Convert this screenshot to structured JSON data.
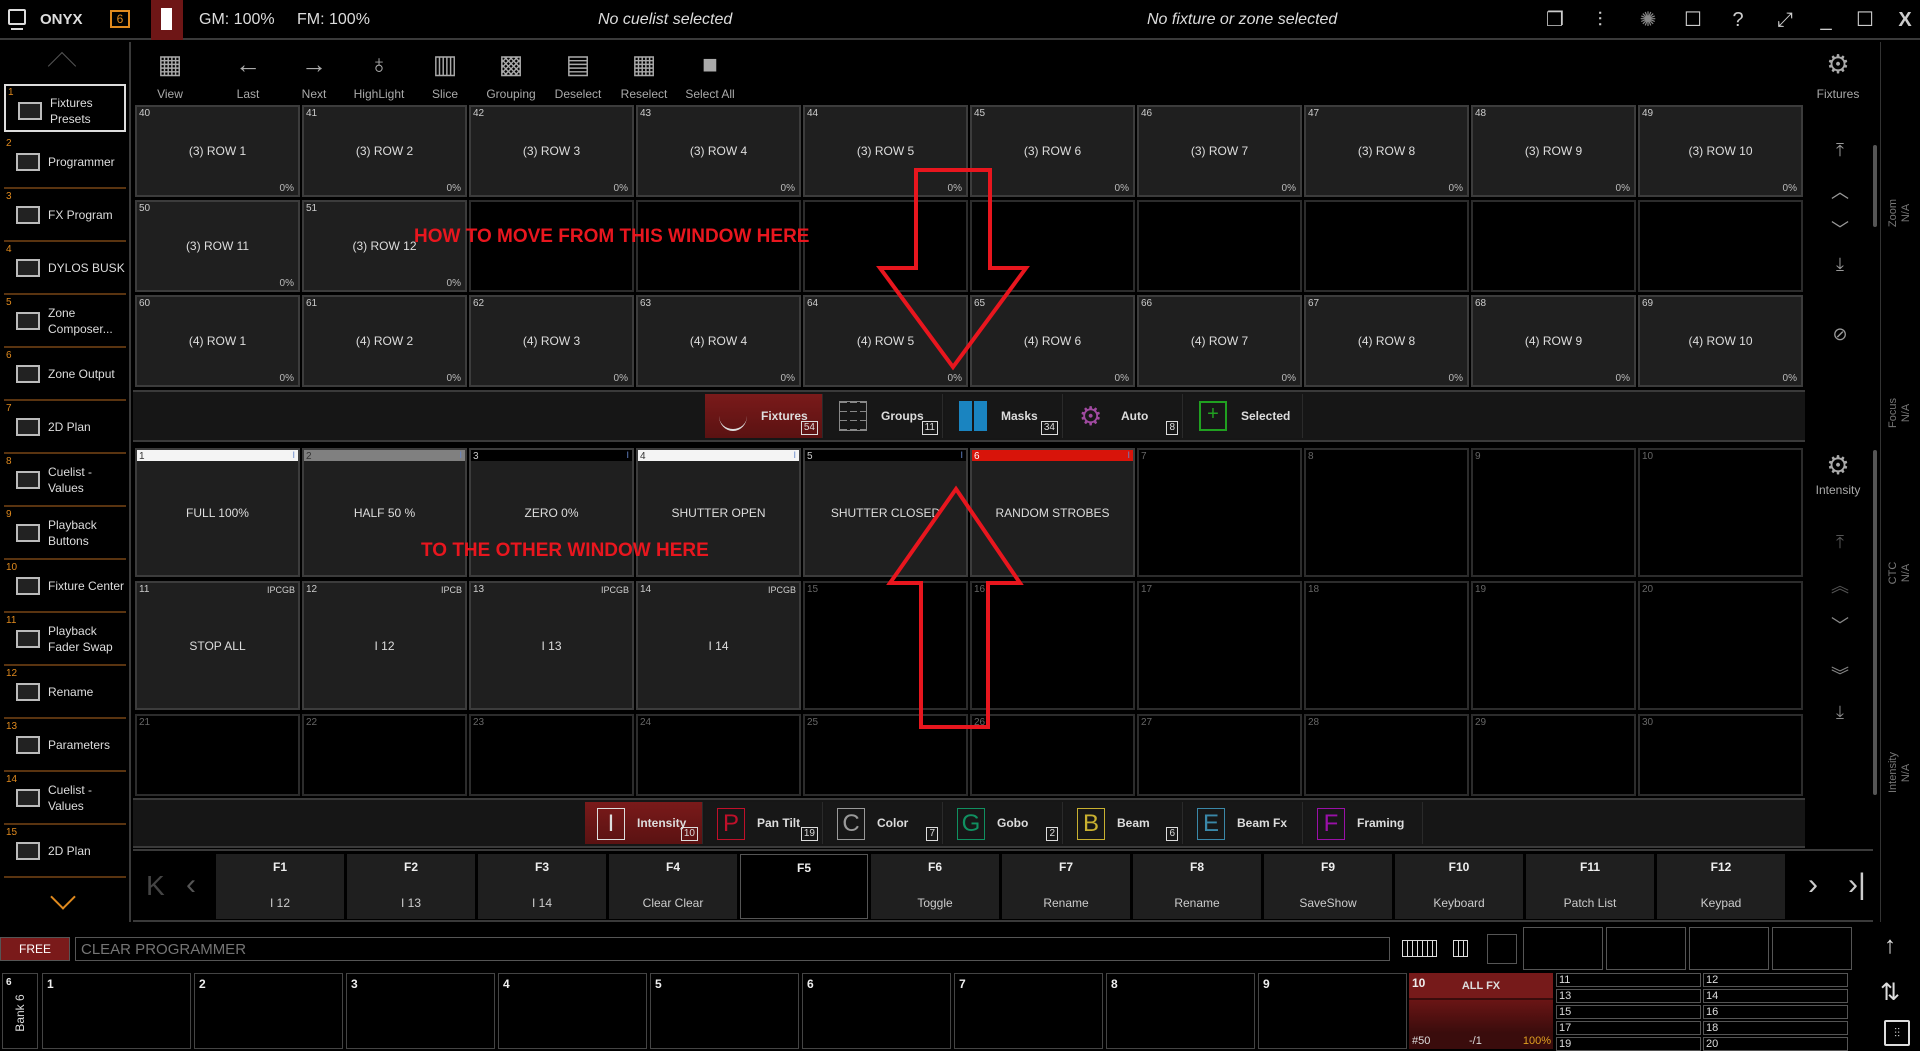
{
  "topbar": {
    "app": "ONYX",
    "gm": "GM: 100%",
    "fm": "FM: 100%",
    "cuelist_status": "No cuelist selected",
    "fixture_status": "No fixture or zone selected",
    "icons": [
      "windows-icon",
      "sliders-icon",
      "spinner-icon",
      "chat-icon",
      "help-icon",
      "fullscreen-icon",
      "minimize-icon",
      "maximize-icon",
      "close-icon"
    ],
    "help_glyph": "?",
    "close_glyph": "X",
    "accent": "#e08a1e"
  },
  "sidebar": {
    "items": [
      {
        "num": "1",
        "label": "Fixtures Presets",
        "icon": "asterisk-icon"
      },
      {
        "num": "2",
        "label": "Programmer",
        "icon": "bars-icon"
      },
      {
        "num": "3",
        "label": "FX Program",
        "icon": "window-icon"
      },
      {
        "num": "4",
        "label": "DYLOS BUSK",
        "icon": "window-icon"
      },
      {
        "num": "5",
        "label": "Zone Composer...",
        "icon": "window-icon"
      },
      {
        "num": "6",
        "label": "Zone Output",
        "icon": "film-play-icon"
      },
      {
        "num": "7",
        "label": "2D Plan",
        "icon": "window-icon"
      },
      {
        "num": "8",
        "label": "Cuelist - Values",
        "icon": "window-icon"
      },
      {
        "num": "9",
        "label": "Playback Buttons",
        "icon": "button-grid-icon"
      },
      {
        "num": "10",
        "label": "Fixture Center",
        "icon": "fixture-icon"
      },
      {
        "num": "11",
        "label": "Playback Fader Swap",
        "icon": "swap-icon"
      },
      {
        "num": "12",
        "label": "Rename",
        "icon": "table-icon"
      },
      {
        "num": "13",
        "label": "Parameters",
        "icon": "parameters-icon"
      },
      {
        "num": "14",
        "label": "Cuelist - Values",
        "icon": "window-icon"
      },
      {
        "num": "15",
        "label": "2D Plan",
        "icon": "window-icon"
      }
    ]
  },
  "toolbar": {
    "items": [
      {
        "label": "View",
        "icon": "grid-icon",
        "glyph": "▦"
      },
      {
        "label": "Last",
        "icon": "arrow-left-icon",
        "glyph": "←"
      },
      {
        "label": "Next",
        "icon": "arrow-right-icon",
        "glyph": "→"
      },
      {
        "label": "HighLight",
        "icon": "bulb-icon",
        "glyph": "♁"
      },
      {
        "label": "Slice",
        "icon": "slice-icon",
        "glyph": "▥"
      },
      {
        "label": "Grouping",
        "icon": "grouping-icon",
        "glyph": "▩"
      },
      {
        "label": "Deselect",
        "icon": "deselect-icon",
        "glyph": "▤"
      },
      {
        "label": "Reselect",
        "icon": "reselect-icon",
        "glyph": "▦"
      },
      {
        "label": "Select All",
        "icon": "select-all-icon",
        "glyph": "■"
      }
    ],
    "right_label": "Fixtures"
  },
  "upper_grid": {
    "cells": [
      {
        "n": "40",
        "t": "(3) ROW 1",
        "p": "0%"
      },
      {
        "n": "41",
        "t": "(3) ROW 2",
        "p": "0%"
      },
      {
        "n": "42",
        "t": "(3) ROW 3",
        "p": "0%"
      },
      {
        "n": "43",
        "t": "(3) ROW 4",
        "p": "0%"
      },
      {
        "n": "44",
        "t": "(3) ROW 5",
        "p": "0%"
      },
      {
        "n": "45",
        "t": "(3) ROW 6",
        "p": "0%"
      },
      {
        "n": "46",
        "t": "(3) ROW 7",
        "p": "0%"
      },
      {
        "n": "47",
        "t": "(3) ROW 8",
        "p": "0%"
      },
      {
        "n": "48",
        "t": "(3) ROW 9",
        "p": "0%"
      },
      {
        "n": "49",
        "t": "(3) ROW 10",
        "p": "0%"
      },
      {
        "n": "50",
        "t": "(3) ROW 11",
        "p": "0%"
      },
      {
        "n": "51",
        "t": "(3) ROW 12",
        "p": "0%"
      },
      {
        "n": "",
        "t": "",
        "p": ""
      },
      {
        "n": "",
        "t": "",
        "p": ""
      },
      {
        "n": "",
        "t": "",
        "p": ""
      },
      {
        "n": "",
        "t": "",
        "p": ""
      },
      {
        "n": "",
        "t": "",
        "p": ""
      },
      {
        "n": "",
        "t": "",
        "p": ""
      },
      {
        "n": "",
        "t": "",
        "p": ""
      },
      {
        "n": "",
        "t": "",
        "p": ""
      },
      {
        "n": "60",
        "t": "(4) ROW 1",
        "p": "0%"
      },
      {
        "n": "61",
        "t": "(4) ROW 2",
        "p": "0%"
      },
      {
        "n": "62",
        "t": "(4) ROW 3",
        "p": "0%"
      },
      {
        "n": "63",
        "t": "(4) ROW 4",
        "p": "0%"
      },
      {
        "n": "64",
        "t": "(4) ROW 5",
        "p": "0%"
      },
      {
        "n": "65",
        "t": "(4) ROW 6",
        "p": "0%"
      },
      {
        "n": "66",
        "t": "(4) ROW 7",
        "p": "0%"
      },
      {
        "n": "67",
        "t": "(4) ROW 8",
        "p": "0%"
      },
      {
        "n": "68",
        "t": "(4) ROW 9",
        "p": "0%"
      },
      {
        "n": "69",
        "t": "(4) ROW 10",
        "p": "0%"
      }
    ]
  },
  "fixture_tabs": [
    {
      "label": "Fixtures",
      "count": "54",
      "icon": "fixture-icon",
      "active": true
    },
    {
      "label": "Groups",
      "count": "11",
      "icon": "groups-icon"
    },
    {
      "label": "Masks",
      "count": "34",
      "icon": "masks-icon",
      "color": "#1a84c0"
    },
    {
      "label": "Auto",
      "count": "8",
      "icon": "gears-icon",
      "color": "#a04aa0"
    },
    {
      "label": "Selected",
      "count": "",
      "icon": "selected-icon",
      "color": "#20a020"
    }
  ],
  "lower_grid": {
    "cells": [
      {
        "n": "1",
        "t": "FULL 100%",
        "bar": "#f4f4f4",
        "tag": "I"
      },
      {
        "n": "2",
        "t": "HALF 50 %",
        "bar": "#808080",
        "tag": "I"
      },
      {
        "n": "3",
        "t": "ZERO 0%",
        "bar": "#000000",
        "tag": "I"
      },
      {
        "n": "4",
        "t": "SHUTTER OPEN",
        "bar": "#f4f4f4",
        "tag": "I"
      },
      {
        "n": "5",
        "t": "SHUTTER CLOSED",
        "bar": "#000000",
        "tag": "I"
      },
      {
        "n": "6",
        "t": "RANDOM STROBES",
        "bar": "#d8140a",
        "tag": "I"
      },
      {
        "n": "7"
      },
      {
        "n": "8"
      },
      {
        "n": "9"
      },
      {
        "n": "10"
      },
      {
        "n": "11",
        "t": "STOP ALL",
        "tag": "IPCGB"
      },
      {
        "n": "12",
        "t": "I 12",
        "tag": "IPCB"
      },
      {
        "n": "13",
        "t": "I 13",
        "tag": "IPCGB"
      },
      {
        "n": "14",
        "t": "I 14",
        "tag": "IPCGB"
      },
      {
        "n": "15"
      },
      {
        "n": "16"
      },
      {
        "n": "17"
      },
      {
        "n": "18"
      },
      {
        "n": "19"
      },
      {
        "n": "20"
      },
      {
        "n": "21"
      },
      {
        "n": "22"
      },
      {
        "n": "23"
      },
      {
        "n": "24"
      },
      {
        "n": "25"
      },
      {
        "n": "26"
      },
      {
        "n": "27"
      },
      {
        "n": "28"
      },
      {
        "n": "29"
      },
      {
        "n": "30"
      }
    ],
    "right_label": "Intensity"
  },
  "attribute_tabs": [
    {
      "letter": "I",
      "label": "Intensity",
      "count": "10",
      "color": "#dddddd",
      "active": true
    },
    {
      "letter": "P",
      "label": "Pan Tilt",
      "count": "19",
      "color": "#c0102a"
    },
    {
      "letter": "C",
      "label": "Color",
      "count": "7",
      "color": "#999999"
    },
    {
      "letter": "G",
      "label": "Gobo",
      "count": "2",
      "color": "#109060"
    },
    {
      "letter": "B",
      "label": "Beam",
      "count": "6",
      "color": "#c8b030"
    },
    {
      "letter": "E",
      "label": "Beam Fx",
      "count": "",
      "color": "#3a88a8"
    },
    {
      "letter": "F",
      "label": "Framing",
      "count": "",
      "color": "#9a10a8"
    }
  ],
  "fkeys": [
    {
      "k": "F1",
      "v": "I 12"
    },
    {
      "k": "F2",
      "v": "I 13"
    },
    {
      "k": "F3",
      "v": "I 14"
    },
    {
      "k": "F4",
      "v": "Clear Clear"
    },
    {
      "k": "F5",
      "v": ""
    },
    {
      "k": "F6",
      "v": "Toggle"
    },
    {
      "k": "F7",
      "v": "Rename"
    },
    {
      "k": "F8",
      "v": "Rename"
    },
    {
      "k": "F9",
      "v": "SaveShow"
    },
    {
      "k": "F10",
      "v": "Keyboard"
    },
    {
      "k": "F11",
      "v": "Patch List"
    },
    {
      "k": "F12",
      "v": "Keypad"
    }
  ],
  "side_readouts": [
    {
      "label": "Zoom",
      "value": "N/A"
    },
    {
      "label": "Focus",
      "value": "N/A"
    },
    {
      "label": "CTC",
      "value": "N/A"
    },
    {
      "label": "Intensity",
      "value": "N/A"
    }
  ],
  "command": {
    "mode": "FREE",
    "placeholder": "CLEAR PROGRAMMER"
  },
  "playbacks": {
    "bank_num": "6",
    "bank_label": "Bank 6",
    "slots": [
      "1",
      "2",
      "3",
      "4",
      "5",
      "6",
      "7",
      "8",
      "9"
    ],
    "active": {
      "num": "10",
      "name": "ALL FX",
      "cue": "#50",
      "step": "-/1",
      "level": "100%"
    },
    "small": [
      "11",
      "12",
      "13",
      "14",
      "15",
      "16",
      "17",
      "18",
      "19",
      "20"
    ]
  },
  "annotations": {
    "top": "HOW TO MOVE FROM THIS WINDOW HERE",
    "bottom": "TO THE OTHER WINDOW HERE",
    "color": "#e8161e"
  }
}
